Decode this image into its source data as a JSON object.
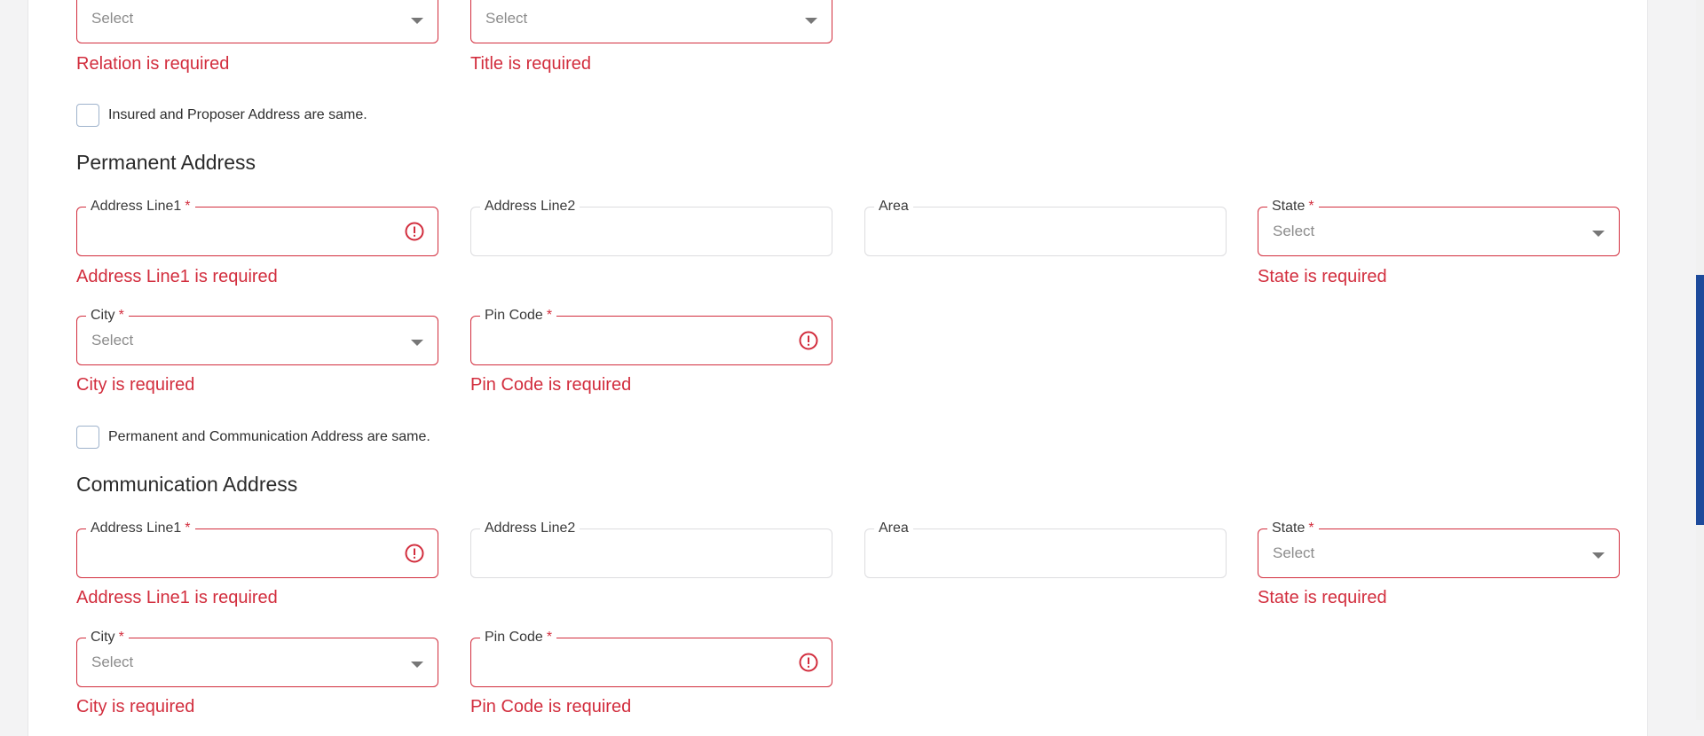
{
  "top_row": {
    "relation": {
      "placeholder": "Select",
      "error": "Relation is required"
    },
    "title": {
      "placeholder": "Select",
      "error": "Title is required"
    }
  },
  "insured_same_checkbox": {
    "label": "Insured and Proposer Address are same.",
    "checked": false
  },
  "permanent": {
    "heading": "Permanent Address",
    "address_line1": {
      "label": "Address Line1",
      "required": "*",
      "value": "",
      "error": "Address Line1 is required"
    },
    "address_line2": {
      "label": "Address Line2",
      "value": ""
    },
    "area": {
      "label": "Area",
      "value": ""
    },
    "state": {
      "label": "State",
      "required": "*",
      "placeholder": "Select",
      "error": "State is required"
    },
    "city": {
      "label": "City",
      "required": "*",
      "placeholder": "Select",
      "error": "City is required"
    },
    "pin_code": {
      "label": "Pin Code",
      "required": "*",
      "value": "",
      "error": "Pin Code is required"
    }
  },
  "comm_same_checkbox": {
    "label": "Permanent and Communication Address are same.",
    "checked": false
  },
  "communication": {
    "heading": "Communication Address",
    "address_line1": {
      "label": "Address Line1",
      "required": "*",
      "value": "",
      "error": "Address Line1 is required"
    },
    "address_line2": {
      "label": "Address Line2",
      "value": ""
    },
    "area": {
      "label": "Area",
      "value": ""
    },
    "state": {
      "label": "State",
      "required": "*",
      "placeholder": "Select",
      "error": "State is required"
    },
    "city": {
      "label": "City",
      "required": "*",
      "placeholder": "Select",
      "error": "City is required"
    },
    "pin_code": {
      "label": "Pin Code",
      "required": "*",
      "value": "",
      "error": "Pin Code is required"
    }
  },
  "icons": {
    "dropdown": "caret-down-icon",
    "error": "error-circle-icon"
  },
  "colors": {
    "error": "#d22d3d",
    "scrollbar_thumb": "#1d4a9b",
    "border": "#dcdcdf"
  }
}
